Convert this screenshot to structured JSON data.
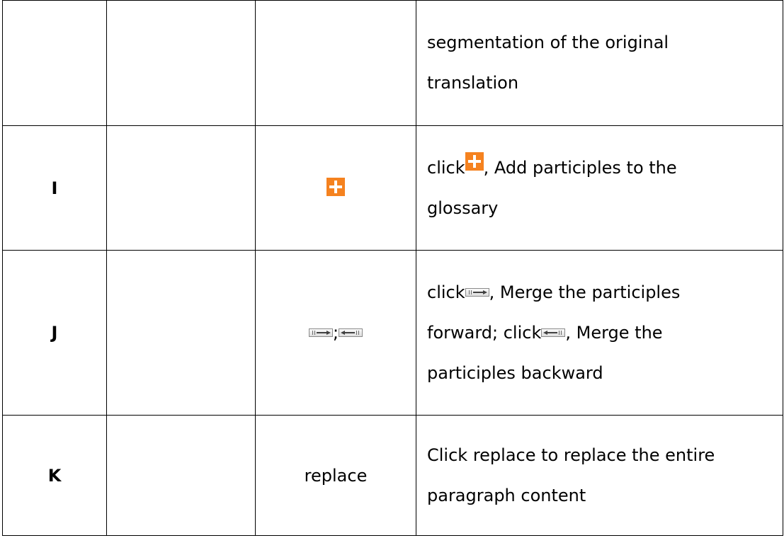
{
  "rows": [
    {
      "key": "",
      "col2": "",
      "icon": "",
      "desc": [
        "segmentation of the original",
        "translation"
      ]
    },
    {
      "key": "I",
      "col2": "",
      "icon": "plus-icon",
      "desc_before": "click",
      "desc_after": ", Add participles to the",
      "desc_line2": "glossary"
    },
    {
      "key": "J",
      "col2": "",
      "icon": "merge-forward-icon;merge-backward-icon",
      "icon_separator": ";",
      "desc_l1_before": "click",
      "desc_l1_after": ", Merge the participles",
      "desc_l2_before": "forward; click",
      "desc_l2_after": ", Merge the",
      "desc_l3": "participles backward"
    },
    {
      "key": "K",
      "col2": "",
      "icon_text": "replace",
      "desc": [
        "Click replace to replace the entire",
        "paragraph content"
      ]
    }
  ],
  "colors": {
    "plus_icon_bg": "#f5821f",
    "border": "#000000"
  }
}
